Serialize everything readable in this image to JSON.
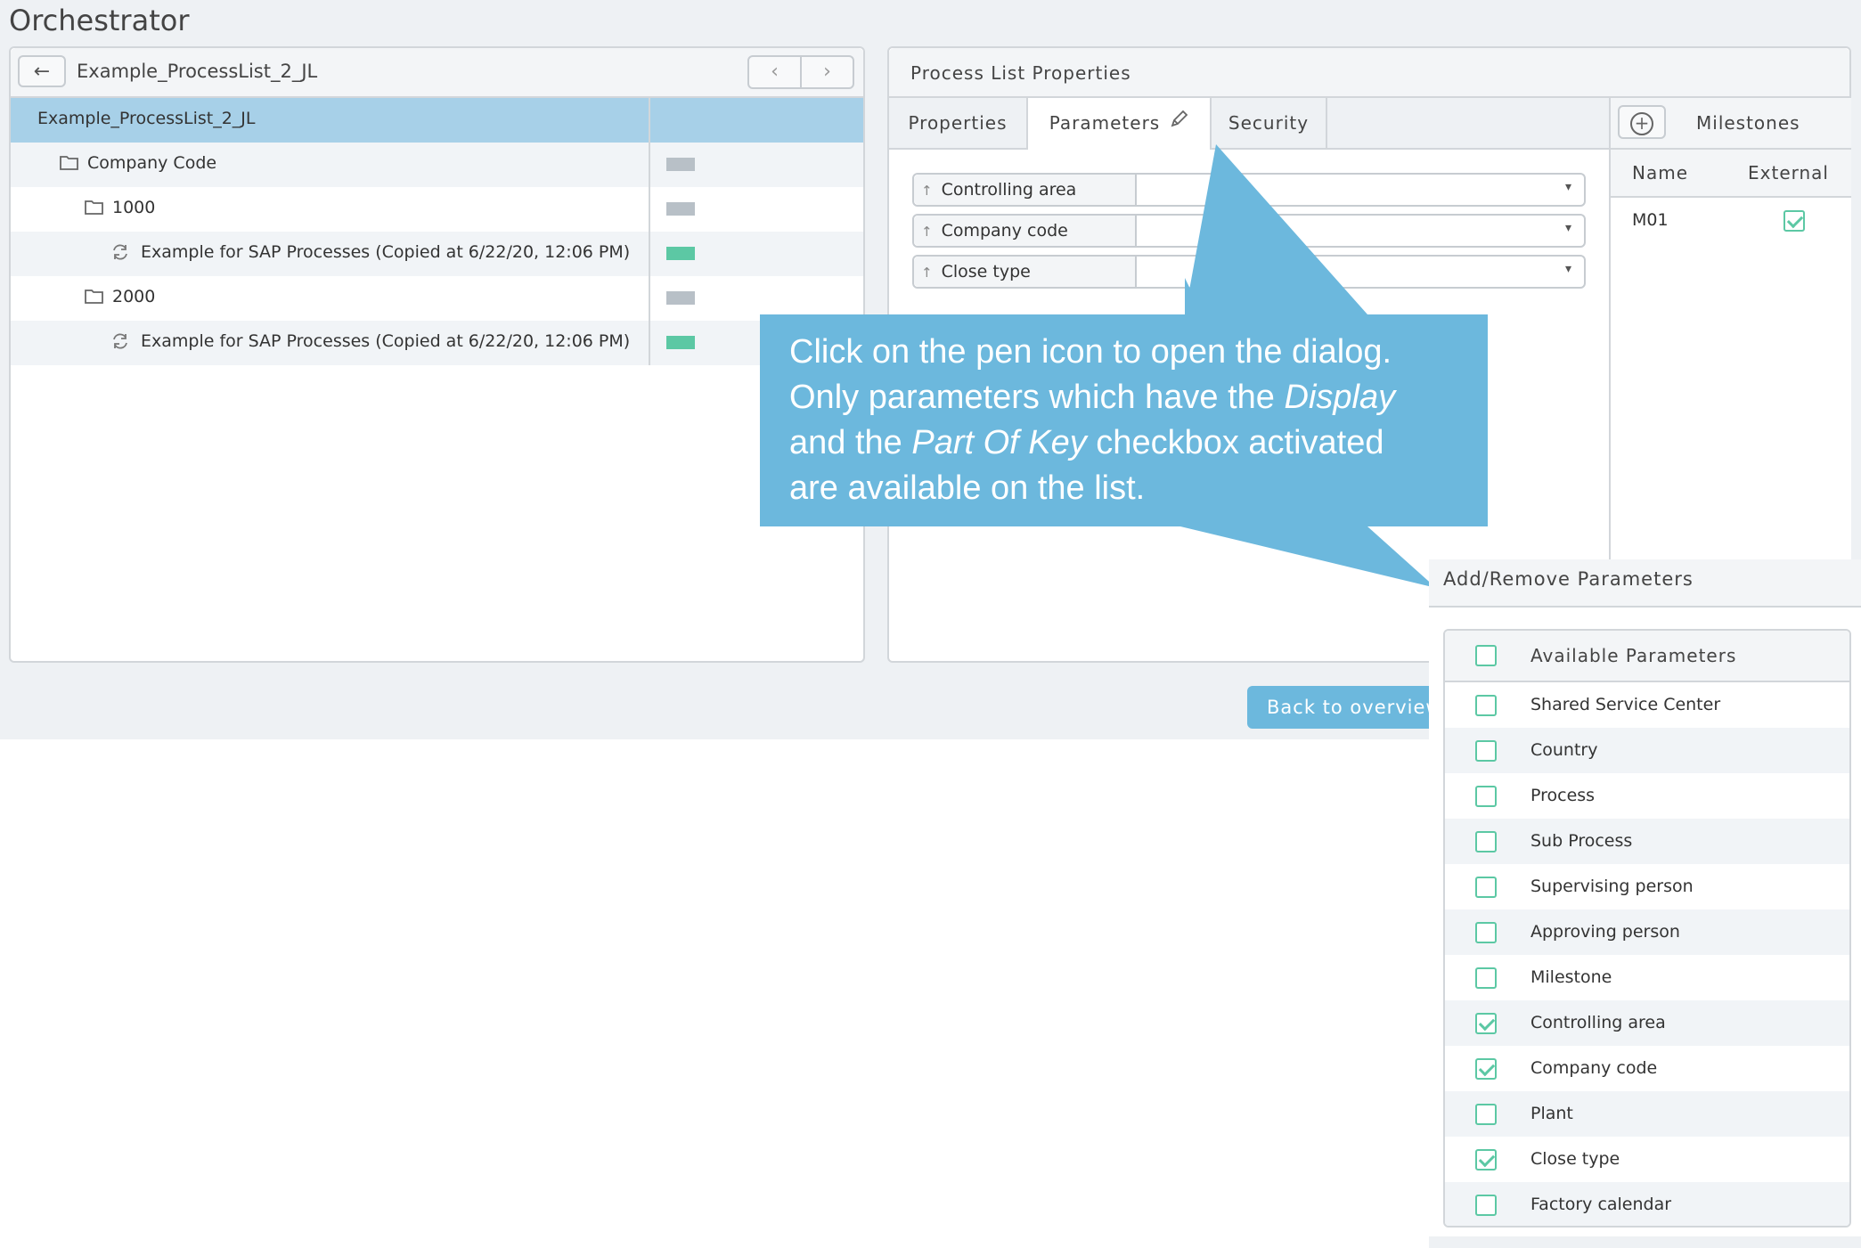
{
  "app": {
    "title": "Orchestrator"
  },
  "left_panel": {
    "back_icon": "arrow-left-icon",
    "title": "Example_ProcessList_2_JL",
    "nav_prev": "‹",
    "nav_next": "›",
    "tree": [
      {
        "label": "Example_ProcessList_2_JL",
        "icon": "",
        "level": 0,
        "selected": true,
        "marker": ""
      },
      {
        "label": "Company Code",
        "icon": "folder-icon",
        "level": 1,
        "selected": false,
        "marker": "#b8c0c7"
      },
      {
        "label": "1000",
        "icon": "folder-icon",
        "level": 2,
        "selected": false,
        "marker": "#b8c0c7"
      },
      {
        "label": "Example for SAP Processes (Copied at 6/22/20, 12:06 PM)",
        "icon": "process-icon",
        "level": 3,
        "selected": false,
        "marker": "#5cc8a4"
      },
      {
        "label": "2000",
        "icon": "folder-icon",
        "level": 2,
        "selected": false,
        "marker": "#b8c0c7"
      },
      {
        "label": "Example for SAP Processes (Copied at 6/22/20, 12:06 PM)",
        "icon": "process-icon",
        "level": 3,
        "selected": false,
        "marker": "#5cc8a4"
      }
    ]
  },
  "right_panel": {
    "title": "Process List Properties",
    "tabs": [
      {
        "label": "Properties",
        "active": false
      },
      {
        "label": "Parameters",
        "active": true
      },
      {
        "label": "Security",
        "active": false
      }
    ],
    "parameters": [
      {
        "label": "Controlling area",
        "value": ""
      },
      {
        "label": "Company code",
        "value": ""
      },
      {
        "label": "Close type",
        "value": ""
      }
    ],
    "milestones": {
      "title": "Milestones",
      "columns": [
        "Name",
        "External"
      ],
      "rows": [
        {
          "name": "M01",
          "external": true
        }
      ]
    }
  },
  "footer": {
    "back_button": "Back to overview"
  },
  "callout": {
    "line1": "Click on the pen icon to open the dialog.",
    "line2_a": "Only parameters which have the ",
    "line2_em": "Display",
    "line3_a": "and the ",
    "line3_em": "Part Of Key",
    "line3_b": " checkbox activated",
    "line4": "are available on the list.",
    "color": "#6cb8dd"
  },
  "dialog": {
    "title": "Add/Remove Parameters",
    "header": "Available Parameters",
    "items": [
      {
        "label": "Shared Service Center",
        "checked": false
      },
      {
        "label": "Country",
        "checked": false
      },
      {
        "label": "Process",
        "checked": false
      },
      {
        "label": "Sub Process",
        "checked": false
      },
      {
        "label": "Supervising person",
        "checked": false
      },
      {
        "label": "Approving person",
        "checked": false
      },
      {
        "label": "Milestone",
        "checked": false
      },
      {
        "label": "Controlling area",
        "checked": true
      },
      {
        "label": "Company code",
        "checked": true
      },
      {
        "label": "Plant",
        "checked": false
      },
      {
        "label": "Close type",
        "checked": true
      },
      {
        "label": "Factory calendar",
        "checked": false
      }
    ]
  }
}
